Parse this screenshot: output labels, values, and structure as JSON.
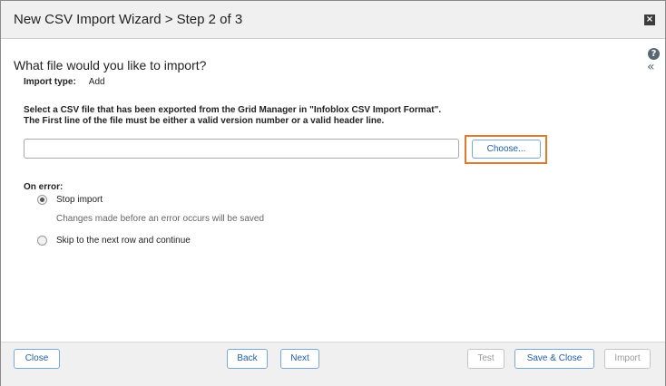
{
  "window": {
    "title": "New CSV Import Wizard > Step 2 of 3"
  },
  "icons": {
    "close": "close-icon",
    "help": "help-icon",
    "collapse": "double-chevron-left-icon"
  },
  "main": {
    "heading": "What file would you like to import?",
    "import_type_label": "Import type:",
    "import_type_value": "Add",
    "description_line1": "Select a CSV file that has been exported from the Grid Manager in \"Infoblox CSV Import Format\".",
    "description_line2": "The First line of the file must be either a valid version number or a valid header line.",
    "file_value": "",
    "choose_label": "Choose..."
  },
  "on_error": {
    "label": "On error:",
    "options": [
      {
        "label": "Stop import",
        "selected": true
      },
      {
        "label": "Skip to the next row and continue",
        "selected": false
      }
    ],
    "hint": "Changes made before an error occurs will be saved"
  },
  "footer": {
    "close": "Close",
    "back": "Back",
    "next": "Next",
    "test": "Test",
    "save_close": "Save & Close",
    "import": "Import"
  },
  "colors": {
    "accent": "#1f5fa8",
    "highlight": "#e07b2e",
    "disabled": "#9a9a9a"
  }
}
